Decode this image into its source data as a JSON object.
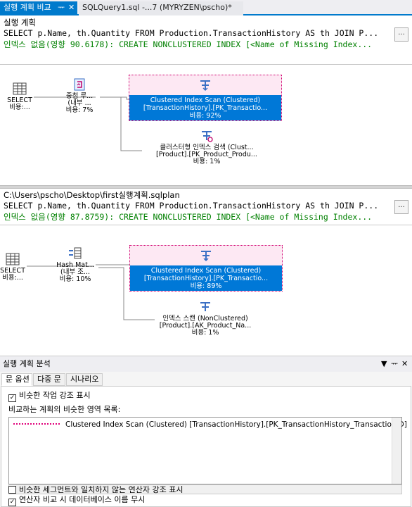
{
  "tabs": {
    "active": {
      "label": "실행 계획 비교",
      "pin": "ᅲ",
      "close": "✕"
    },
    "second": {
      "label": "SQLQuery1.sql -...7 (MYRYZEN\\pscho)*"
    }
  },
  "plan1": {
    "header": "실행 계획",
    "sql": "SELECT p.Name, th.Quantity FROM Production.TransactionHistory AS th JOIN P...",
    "missing_index": "인덱스 없음(영향 90.6178): CREATE NONCLUSTERED INDEX [<Name of Missing Index...",
    "ellipsis": "...",
    "select": {
      "line1": "SELECT",
      "line2": "비용:..."
    },
    "join": {
      "line1": "중첩 루...",
      "line2": "(내부 ...",
      "line3": "비용: 7%"
    },
    "scan": {
      "line1": "Clustered Index Scan (Clustered)",
      "line2": "[TransactionHistory].[PK_Transactio...",
      "line3": "비용: 92%"
    },
    "seek": {
      "line1": "클러스터형 인덱스 검색 (Clust...",
      "line2": "[Product].[PK_Product_Produ...",
      "line3": "비용: 1%"
    }
  },
  "plan2": {
    "header": "C:\\Users\\pscho\\Desktop\\first실행계획.sqlplan",
    "sql": "SELECT p.Name, th.Quantity FROM Production.TransactionHistory AS th JOIN P...",
    "missing_index": "인덱스 없음(영향 87.8759): CREATE NONCLUSTERED INDEX [<Name of Missing Index...",
    "ellipsis": "...",
    "select": {
      "line1": "SELECT",
      "line2": "비용:..."
    },
    "join": {
      "line1": "Hash Mat...",
      "line2": "(내부 조...",
      "line3": "비용: 10%"
    },
    "scan": {
      "line1": "Clustered Index Scan (Clustered)",
      "line2": "[TransactionHistory].[PK_Transactio...",
      "line3": "비용: 89%"
    },
    "seek": {
      "line1": "인덱스 스캔 (NonClustered)",
      "line2": "[Product].[AK_Product_Na...",
      "line3": "비용: 1%"
    }
  },
  "analysis": {
    "title": "실행 계획 분석",
    "title_controls": {
      "dropdown": "▼",
      "pin": "ᅲ",
      "close": "✕"
    },
    "tabs": [
      "문 옵션",
      "다중 문",
      "시나리오"
    ],
    "highlight_similar": {
      "label": "비슷한 작업 강조 표시",
      "checked": true
    },
    "list_label": "비교하는 계획의 비슷한 영역 목록:",
    "list_items": [
      "Clustered Index Scan (Clustered) [TransactionHistory].[PK_TransactionHistory_TransactionID]"
    ],
    "highlight_unmatched": {
      "label": "비슷한 세그먼트와 일치하지 않는 연산자 강조 표시",
      "checked": false
    },
    "ignore_db_name": {
      "label": "연산자 비교 시 데이터베이스 이름 무시",
      "checked": true
    }
  },
  "colors": {
    "accent": "#007acc",
    "selection": "#0078d7",
    "missing_index": "#008000",
    "similar_highlight": "#e0007a"
  }
}
